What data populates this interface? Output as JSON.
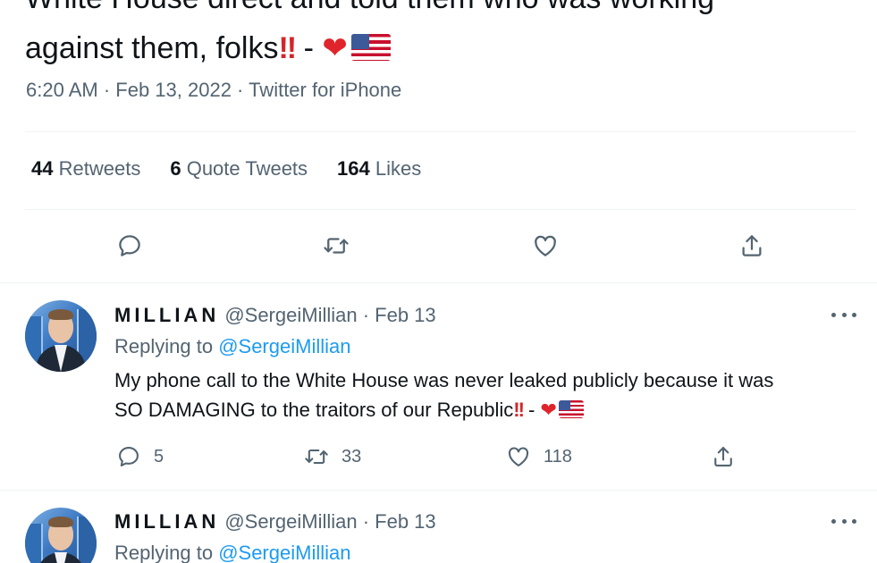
{
  "main_tweet": {
    "text_line1": "White House direct and told them who was working",
    "text_line2_prefix": "against them, folks",
    "text_line2_bangs": "!!",
    "text_line2_dash": " - ",
    "heart_emoji": "❤",
    "meta": "6:20 AM · Feb 13, 2022 · Twitter for iPhone",
    "stats": {
      "retweets_count": "44",
      "retweets_label": "Retweets",
      "quotes_count": "6",
      "quotes_label": "Quote Tweets",
      "likes_count": "164",
      "likes_label": "Likes"
    }
  },
  "replies": [
    {
      "display_name": "MILLIAN",
      "handle_time": " @SergeiMillian · Feb 13",
      "replying_prefix": "Replying to ",
      "replying_handle": "@SergeiMillian",
      "text_line1": "My phone call to the White House was never leaked publicly because it was",
      "text_line2_prefix": "SO DAMAGING to the traitors of our Republic",
      "text_line2_bangs": "!!",
      "text_line2_dash": " - ",
      "heart_emoji": "❤",
      "reply_count": "5",
      "retweet_count": "33",
      "like_count": "118"
    },
    {
      "display_name": "MILLIAN",
      "handle_time": " @SergeiMillian · Feb 13",
      "replying_prefix": "Replying to ",
      "replying_handle": "@SergeiMillian"
    }
  ],
  "colors": {
    "text": "#0f1419",
    "secondary": "#536471",
    "link": "#1d9bf0",
    "divider": "#eff3f4",
    "heart": "#e0242b"
  },
  "icons": [
    "reply-icon",
    "retweet-icon",
    "like-icon",
    "share-icon",
    "more-icon",
    "us-flag-icon",
    "heart-emoji"
  ]
}
